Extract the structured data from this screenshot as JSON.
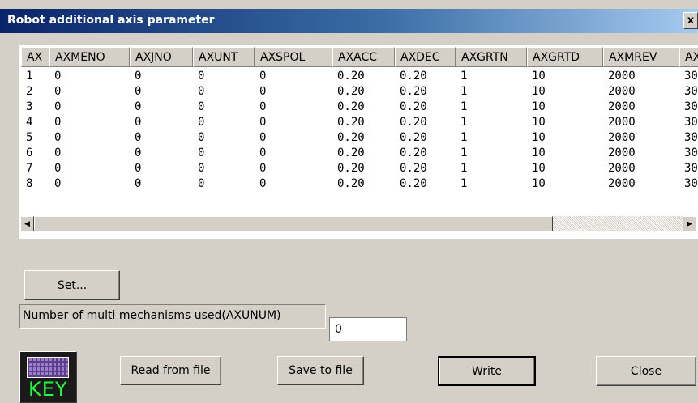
{
  "window": {
    "title": "Robot additional axis parameter",
    "close_glyph": "x"
  },
  "grid": {
    "columns": [
      "AX",
      "AXMENO",
      "AXJNO",
      "AXUNT",
      "AXSPOL",
      "AXACC",
      "AXDEC",
      "AXGRTN",
      "AXGRTD",
      "AXMREV",
      "AX"
    ],
    "rows": [
      [
        "1",
        "0",
        "0",
        "0",
        "0",
        "0.20",
        "0.20",
        "1",
        "10",
        "2000",
        "30"
      ],
      [
        "2",
        "0",
        "0",
        "0",
        "0",
        "0.20",
        "0.20",
        "1",
        "10",
        "2000",
        "30"
      ],
      [
        "3",
        "0",
        "0",
        "0",
        "0",
        "0.20",
        "0.20",
        "1",
        "10",
        "2000",
        "30"
      ],
      [
        "4",
        "0",
        "0",
        "0",
        "0",
        "0.20",
        "0.20",
        "1",
        "10",
        "2000",
        "30"
      ],
      [
        "5",
        "0",
        "0",
        "0",
        "0",
        "0.20",
        "0.20",
        "1",
        "10",
        "2000",
        "30"
      ],
      [
        "6",
        "0",
        "0",
        "0",
        "0",
        "0.20",
        "0.20",
        "1",
        "10",
        "2000",
        "30"
      ],
      [
        "7",
        "0",
        "0",
        "0",
        "0",
        "0.20",
        "0.20",
        "1",
        "10",
        "2000",
        "30"
      ],
      [
        "8",
        "0",
        "0",
        "0",
        "0",
        "0.20",
        "0.20",
        "1",
        "10",
        "2000",
        "30"
      ]
    ]
  },
  "scrollbar": {
    "left_glyph": "◀",
    "right_glyph": "▶"
  },
  "buttons": {
    "set": "Set...",
    "read_from_file": "Read from file",
    "save_to_file": "Save to file",
    "write": "Write",
    "close": "Close"
  },
  "axunum": {
    "label": "Number of multi mechanisms used(AXUNUM)",
    "value": "0"
  },
  "key_icon": {
    "text": "KEY",
    "icon": "keyboard-icon"
  }
}
